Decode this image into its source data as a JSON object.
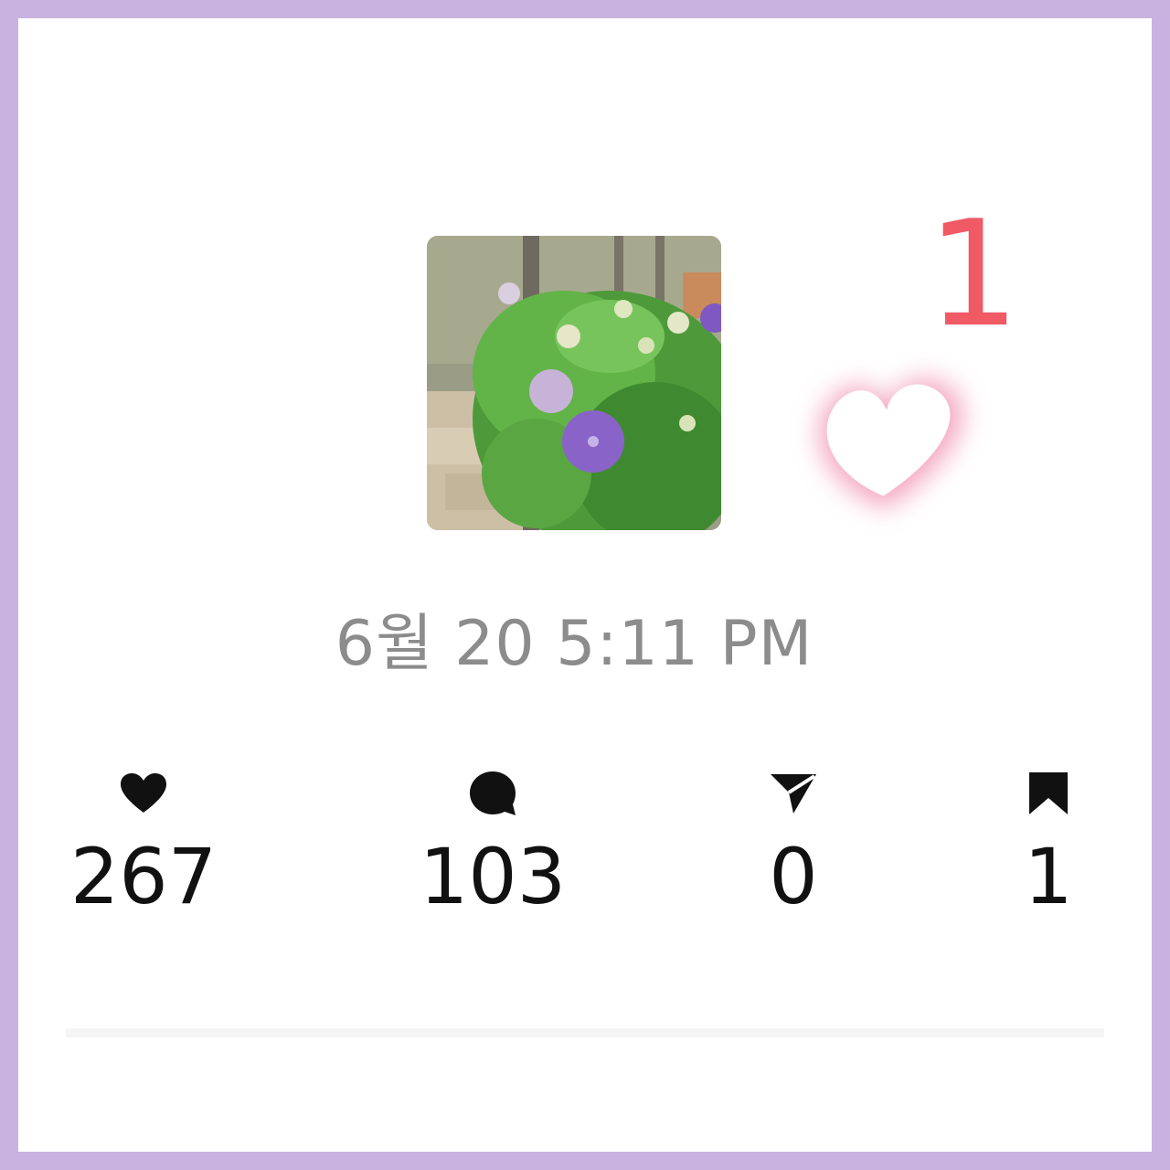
{
  "post": {
    "timestamp": "6월 20 5:11 PM",
    "sticker_count": "1"
  },
  "stats": {
    "likes": {
      "icon": "heart-icon",
      "value": "267"
    },
    "comments": {
      "icon": "comment-bubble-icon",
      "value": "103"
    },
    "shares": {
      "icon": "send-icon",
      "value": "0"
    },
    "saves": {
      "icon": "bookmark-icon",
      "value": "1"
    }
  },
  "colors": {
    "frame": "#c9b1e0",
    "sticker_number": "#ef5a64",
    "heart_glow": "#f4a6c0",
    "timestamp": "#8c8c8c",
    "stat_text": "#111111"
  }
}
